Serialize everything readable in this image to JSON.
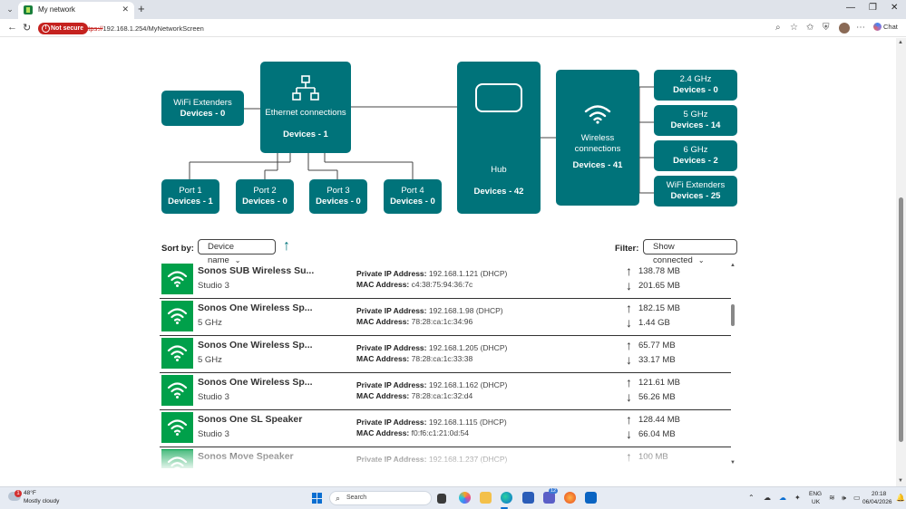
{
  "browser": {
    "tab_title": "My network",
    "security_label": "Not secure",
    "url_scheme": "https://",
    "url_rest": "192.168.1.254/MyNetworkScreen",
    "chat_label": "Chat"
  },
  "diagram": {
    "wifi_extenders_left": {
      "label": "WiFi Extenders",
      "count": "Devices - 0"
    },
    "ethernet": {
      "label": "Ethernet connections",
      "count": "Devices - 1"
    },
    "ports": [
      {
        "label": "Port 1",
        "count": "Devices - 1"
      },
      {
        "label": "Port 2",
        "count": "Devices - 0"
      },
      {
        "label": "Port 3",
        "count": "Devices - 0"
      },
      {
        "label": "Port 4",
        "count": "Devices - 0"
      }
    ],
    "hub": {
      "label": "Hub",
      "count": "Devices - 42"
    },
    "wireless": {
      "label": "Wireless connections",
      "count": "Devices - 41"
    },
    "bands": [
      {
        "label": "2.4 GHz",
        "count": "Devices - 0"
      },
      {
        "label": "5 GHz",
        "count": "Devices - 14"
      },
      {
        "label": "6 GHz",
        "count": "Devices - 2"
      },
      {
        "label": "WiFi Extenders",
        "count": "Devices - 25"
      }
    ]
  },
  "controls": {
    "sort_label": "Sort by:",
    "sort_value": "Device name",
    "filter_label": "Filter:",
    "filter_value": "Show connected"
  },
  "device_labels": {
    "ip": "Private IP Address:",
    "mac": "MAC Address:"
  },
  "devices": [
    {
      "name": "Sonos SUB Wireless Su...",
      "band": "Studio 3",
      "ip": "192.168.1.121 (DHCP)",
      "mac": "c4:38:75:94:36:7c",
      "up": "138.78 MB",
      "down": "201.65 MB"
    },
    {
      "name": "Sonos One Wireless Sp...",
      "band": "5 GHz",
      "ip": "192.168.1.98 (DHCP)",
      "mac": "78:28:ca:1c:34:96",
      "up": "182.15 MB",
      "down": "1.44 GB"
    },
    {
      "name": "Sonos One Wireless Sp...",
      "band": "5 GHz",
      "ip": "192.168.1.205 (DHCP)",
      "mac": "78:28:ca:1c:33:38",
      "up": "65.77 MB",
      "down": "33.17 MB"
    },
    {
      "name": "Sonos One Wireless Sp...",
      "band": "Studio 3",
      "ip": "192.168.1.162 (DHCP)",
      "mac": "78:28:ca:1c:32:d4",
      "up": "121.61 MB",
      "down": "56.26 MB"
    },
    {
      "name": "Sonos One SL Speaker",
      "band": "Studio 3",
      "ip": "192.168.1.115 (DHCP)",
      "mac": "f0:f6:c1:21:0d:54",
      "up": "128.44 MB",
      "down": "66.04 MB"
    },
    {
      "name": "Sonos Move Speaker",
      "band": "",
      "ip": "192.168.1.237 (DHCP)",
      "mac": "",
      "up": "100 MB",
      "down": ""
    }
  ],
  "taskbar": {
    "weather_badge": "1",
    "weather_temp": "48°F",
    "weather_desc": "Mostly cloudy",
    "search_placeholder": "Search",
    "teams_badge": "12",
    "lang": "ENG",
    "region": "UK",
    "time": "20:18",
    "date": "06/04/2026"
  },
  "colors": {
    "teal": "#00737a",
    "wifi_green": "#00a04a"
  }
}
